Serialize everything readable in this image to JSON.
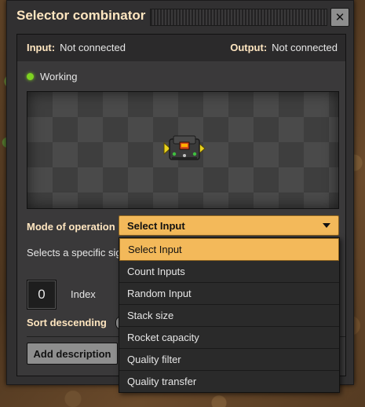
{
  "window": {
    "title": "Selector combinator"
  },
  "io": {
    "input_label": "Input:",
    "input_value": "Not connected",
    "output_label": "Output:",
    "output_value": "Not connected"
  },
  "status": {
    "text": "Working",
    "color": "#7ed321"
  },
  "settings": {
    "mode_label": "Mode of operation",
    "description_text": "Selects a specific sig",
    "index_value": "0",
    "index_label": "Index",
    "sort_label": "Sort descending",
    "add_description_label": "Add description"
  },
  "dropdown": {
    "selected": "Select Input",
    "options": [
      "Select Input",
      "Count Inputs",
      "Random Input",
      "Stack size",
      "Rocket capacity",
      "Quality filter",
      "Quality transfer"
    ]
  },
  "colors": {
    "accent": "#f3b95a",
    "heading": "#ffe6c0",
    "panel": "#3a393a"
  }
}
